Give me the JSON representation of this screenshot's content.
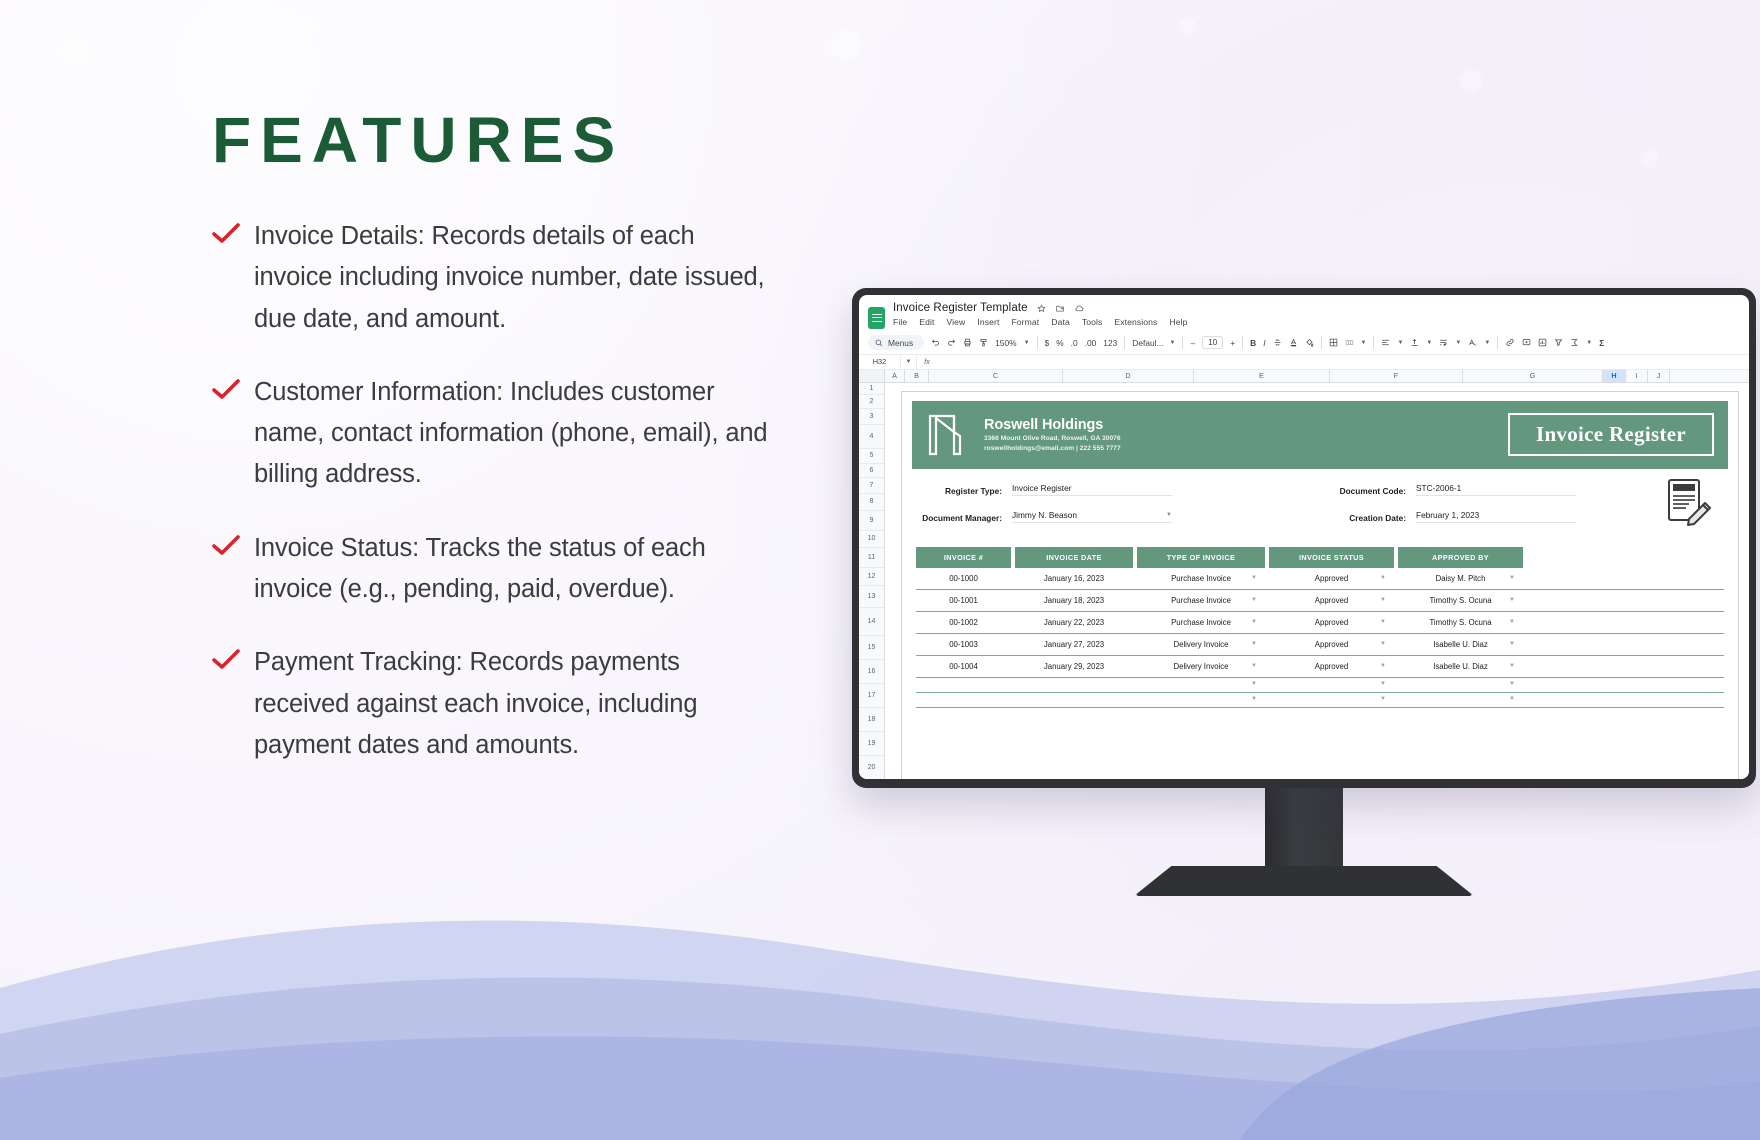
{
  "slide": {
    "title": "FEATURES",
    "title_color": "#1b5c36",
    "check_color": "#d8232a",
    "features": [
      "Invoice Details: Records details of each invoice including invoice number, date issued, due date, and amount.",
      "Customer Information: Includes customer name, contact information (phone, email), and billing address.",
      "Invoice Status: Tracks the status of each invoice (e.g., pending, paid, overdue).",
      "Payment Tracking: Records payments received against each invoice, including payment dates and amounts."
    ]
  },
  "sheets": {
    "doc_title": "Invoice Register Template",
    "title_icons": [
      "star-icon",
      "move-to-folder-icon",
      "cloud-saved-icon"
    ],
    "menu": [
      "File",
      "Edit",
      "View",
      "Insert",
      "Format",
      "Data",
      "Tools",
      "Extensions",
      "Help"
    ],
    "toolbar": {
      "menus_label": "Menus",
      "zoom": "150%",
      "currency": "$",
      "percent": "%",
      "decimal_dec": ".0",
      "decimal_inc": ".00",
      "number_format": "123",
      "font": "Defaul...",
      "font_size": "10",
      "bold": "B",
      "italic": "I",
      "minus": "–",
      "plus": "+"
    },
    "name_box": "H32",
    "formula_value": "",
    "columns": [
      "A",
      "B",
      "C",
      "D",
      "E",
      "F",
      "G",
      "H",
      "I",
      "J"
    ],
    "active_column": "H",
    "rows": [
      "1",
      "2",
      "3",
      "4",
      "5",
      "6",
      "7",
      "8",
      "9",
      "10",
      "11",
      "12",
      "13",
      "14",
      "15",
      "16",
      "17",
      "18",
      "19",
      "20"
    ]
  },
  "invoice": {
    "brand": {
      "name": "Roswell Holdings",
      "address": "3366 Mount Olive Road, Roswell, GA 30076",
      "contact": "roswellholdings@email.com | 222 555 7777"
    },
    "register_title": "Invoice Register",
    "meta": [
      {
        "label": "Register Type:",
        "value": "Invoice Register",
        "dropdown": false
      },
      {
        "label": "Document Code:",
        "value": "STC-2006-1",
        "dropdown": false
      },
      {
        "label": "Document Manager:",
        "value": "Jimmy N. Beason",
        "dropdown": true
      },
      {
        "label": "Creation Date:",
        "value": "February 1, 2023",
        "dropdown": false
      }
    ],
    "table": {
      "headers": [
        "INVOICE #",
        "INVOICE DATE",
        "TYPE OF INVOICE",
        "INVOICE STATUS",
        "APPROVED BY"
      ],
      "rows": [
        [
          "00-1000",
          "January 16, 2023",
          "Purchase Invoice",
          "Approved",
          "Daisy M. Pitch"
        ],
        [
          "00-1001",
          "January 18, 2023",
          "Purchase Invoice",
          "Approved",
          "Timothy S. Ocuna"
        ],
        [
          "00-1002",
          "January 22, 2023",
          "Purchase Invoice",
          "Approved",
          "Timothy S. Ocuna"
        ],
        [
          "00-1003",
          "January 27, 2023",
          "Delivery Invoice",
          "Approved",
          "Isabelle U. Diaz"
        ],
        [
          "00-1004",
          "January 29, 2023",
          "Delivery Invoice",
          "Approved",
          "Isabelle U. Diaz"
        ]
      ],
      "empty_rows": 2
    },
    "accent_color": "#63977e"
  }
}
